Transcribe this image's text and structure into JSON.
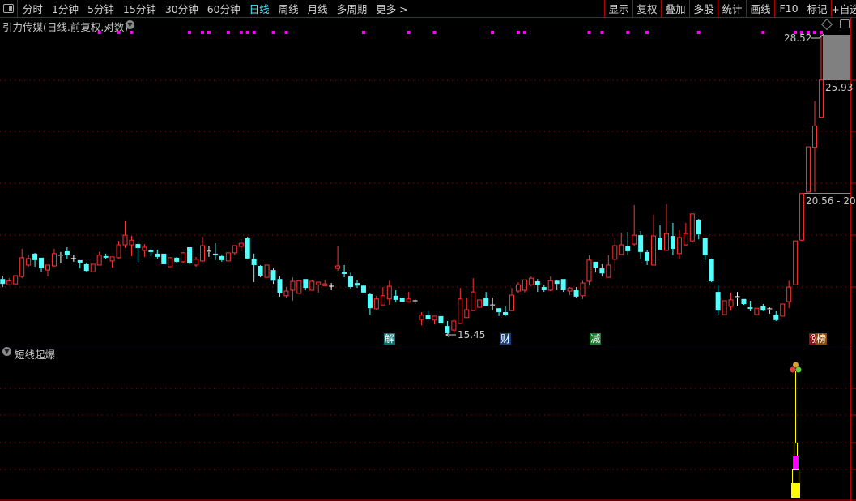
{
  "toolbar": {
    "periods": [
      {
        "label": "分时",
        "active": false
      },
      {
        "label": "1分钟",
        "active": false
      },
      {
        "label": "5分钟",
        "active": false
      },
      {
        "label": "15分钟",
        "active": false
      },
      {
        "label": "30分钟",
        "active": false
      },
      {
        "label": "60分钟",
        "active": false
      },
      {
        "label": "日线",
        "active": true
      },
      {
        "label": "周线",
        "active": false
      },
      {
        "label": "月线",
        "active": false
      },
      {
        "label": "多周期",
        "active": false
      },
      {
        "label": "更多 >",
        "active": false
      }
    ],
    "buttons": [
      "显示",
      "复权",
      "叠加",
      "多股",
      "统计",
      "画线",
      "F10",
      "标记",
      "+自选"
    ]
  },
  "main_panel": {
    "title": "引力传媒(日线.前复权.对数)",
    "labels": {
      "high": "28.52",
      "low": "15.45",
      "last": "25.93",
      "range": "20.56 - 20"
    },
    "badges": [
      {
        "text": "解",
        "candle": 60,
        "bg": "#0f6f70"
      },
      {
        "text": "财",
        "candle": 78,
        "bg": "#1a3f7a"
      },
      {
        "text": "减",
        "candle": 92,
        "bg": "#1a7a2a"
      },
      {
        "text": "涨",
        "candle": 126,
        "bg": "#8a0f0f"
      },
      {
        "text": "榜",
        "candle": 127,
        "bg": "#8a4a0f"
      }
    ]
  },
  "sub_panel": {
    "title": "短线起爆"
  },
  "colors": {
    "up": "#ff3232",
    "down": "#54ffff",
    "flat": "#ffffff",
    "grid": "#8a1010",
    "marker": "#ff00ff",
    "axis": "#c00000",
    "bg": "#000000"
  },
  "chart_data": {
    "type": "candlestick",
    "y_scale": "log",
    "grid": true,
    "ohlc_order": [
      "open",
      "high",
      "low",
      "close"
    ],
    "signal_markers": [
      15,
      18,
      20,
      29,
      31,
      32,
      35,
      37,
      38,
      39,
      42,
      44,
      56,
      63,
      67,
      76,
      80,
      81,
      91,
      93,
      97,
      100,
      108,
      118,
      123,
      124,
      125,
      126,
      127
    ],
    "candles": [
      [
        17.26,
        17.38,
        16.98,
        17.09
      ],
      [
        17.06,
        17.29,
        17.03,
        17.2
      ],
      [
        17.09,
        17.38,
        17.09,
        17.38
      ],
      [
        17.35,
        18.36,
        17.29,
        18.03
      ],
      [
        17.76,
        18.12,
        17.7,
        18.0
      ],
      [
        18.18,
        18.21,
        17.7,
        17.94
      ],
      [
        18.03,
        18.03,
        17.52,
        17.64
      ],
      [
        17.58,
        17.76,
        17.35,
        17.76
      ],
      [
        17.73,
        18.36,
        17.7,
        18.18
      ],
      [
        18.09,
        18.24,
        17.82,
        18.12
      ],
      [
        18.27,
        18.42,
        17.97,
        18.12
      ],
      [
        18.0,
        18.12,
        17.88,
        18.0
      ],
      [
        17.94,
        17.94,
        17.64,
        17.85
      ],
      [
        17.79,
        17.85,
        17.52,
        17.55
      ],
      [
        17.52,
        17.79,
        17.52,
        17.79
      ],
      [
        17.76,
        18.24,
        17.76,
        18.12
      ],
      [
        18.09,
        18.18,
        17.97,
        18.03
      ],
      [
        17.91,
        18.06,
        17.67,
        18.06
      ],
      [
        18.03,
        18.66,
        18.0,
        18.51
      ],
      [
        18.51,
        19.46,
        18.39,
        18.88
      ],
      [
        18.51,
        18.85,
        18.09,
        18.69
      ],
      [
        18.54,
        18.57,
        17.88,
        18.39
      ],
      [
        18.3,
        18.54,
        18.06,
        18.42
      ],
      [
        18.3,
        18.36,
        18.09,
        18.24
      ],
      [
        18.18,
        18.33,
        18.0,
        18.06
      ],
      [
        18.18,
        18.18,
        17.79,
        17.79
      ],
      [
        17.7,
        18.03,
        17.7,
        18.03
      ],
      [
        18.03,
        18.06,
        17.85,
        17.88
      ],
      [
        17.88,
        18.24,
        17.82,
        18.21
      ],
      [
        18.42,
        18.42,
        17.79,
        17.82
      ],
      [
        17.76,
        18.06,
        17.7,
        17.97
      ],
      [
        17.91,
        18.82,
        17.88,
        18.48
      ],
      [
        18.24,
        18.45,
        18.06,
        18.27
      ],
      [
        18.18,
        18.57,
        17.94,
        18.12
      ],
      [
        18.09,
        18.15,
        17.88,
        17.94
      ],
      [
        17.91,
        18.21,
        17.91,
        18.21
      ],
      [
        18.21,
        18.48,
        18.12,
        18.48
      ],
      [
        18.45,
        18.72,
        18.27,
        18.57
      ],
      [
        18.76,
        18.82,
        17.97,
        18.0
      ],
      [
        18.0,
        18.18,
        17.15,
        17.76
      ],
      [
        17.73,
        17.76,
        17.32,
        17.38
      ],
      [
        17.32,
        17.76,
        17.32,
        17.76
      ],
      [
        17.58,
        17.67,
        17.09,
        17.2
      ],
      [
        17.26,
        17.38,
        16.65,
        16.76
      ],
      [
        16.68,
        16.98,
        16.59,
        16.84
      ],
      [
        16.87,
        17.32,
        16.51,
        17.18
      ],
      [
        16.76,
        17.2,
        16.76,
        17.2
      ],
      [
        17.26,
        17.26,
        16.87,
        16.95
      ],
      [
        16.87,
        17.23,
        16.87,
        17.18
      ],
      [
        17.06,
        17.15,
        16.79,
        17.15
      ],
      [
        17.03,
        17.23,
        17.03,
        17.09
      ],
      [
        17.01,
        17.12,
        16.87,
        17.01
      ],
      [
        17.64,
        18.45,
        17.55,
        17.73
      ],
      [
        17.52,
        17.76,
        17.32,
        17.44
      ],
      [
        17.35,
        17.49,
        16.9,
        16.98
      ],
      [
        17.12,
        17.23,
        16.95,
        17.03
      ],
      [
        17.03,
        17.06,
        16.76,
        16.79
      ],
      [
        16.73,
        16.76,
        16.05,
        16.26
      ],
      [
        16.24,
        16.68,
        16.21,
        16.57
      ],
      [
        16.37,
        16.98,
        16.37,
        16.68
      ],
      [
        16.57,
        17.2,
        16.37,
        17.01
      ],
      [
        16.68,
        16.87,
        16.46,
        16.54
      ],
      [
        16.62,
        16.62,
        16.48,
        16.48
      ],
      [
        16.48,
        16.81,
        16.46,
        16.57
      ],
      [
        16.51,
        16.59,
        16.4,
        16.51
      ],
      [
        15.89,
        16.13,
        15.7,
        16.03
      ],
      [
        16.03,
        16.16,
        15.89,
        15.89
      ],
      [
        15.87,
        16.0,
        15.73,
        16.0
      ],
      [
        16.0,
        16.0,
        15.76,
        15.76
      ],
      [
        15.68,
        15.84,
        15.45,
        15.45
      ],
      [
        15.55,
        15.89,
        15.47,
        15.84
      ],
      [
        15.76,
        16.95,
        15.76,
        16.57
      ],
      [
        15.95,
        16.62,
        15.95,
        16.21
      ],
      [
        16.18,
        17.29,
        16.18,
        16.81
      ],
      [
        16.29,
        16.54,
        16.29,
        16.54
      ],
      [
        16.62,
        16.81,
        16.32,
        16.32
      ],
      [
        16.37,
        16.62,
        16.18,
        16.34
      ],
      [
        16.26,
        16.26,
        16.0,
        16.13
      ],
      [
        16.13,
        16.32,
        16.0,
        16.03
      ],
      [
        16.18,
        16.95,
        16.18,
        16.7
      ],
      [
        16.84,
        17.15,
        16.76,
        17.06
      ],
      [
        16.87,
        17.23,
        16.79,
        17.23
      ],
      [
        17.06,
        17.35,
        17.01,
        17.29
      ],
      [
        17.18,
        17.26,
        16.81,
        17.06
      ],
      [
        16.98,
        17.06,
        16.81,
        16.87
      ],
      [
        16.87,
        17.35,
        16.84,
        17.2
      ],
      [
        17.2,
        17.23,
        16.87,
        17.09
      ],
      [
        17.26,
        17.26,
        16.81,
        16.87
      ],
      [
        16.84,
        16.98,
        16.7,
        16.95
      ],
      [
        16.87,
        16.98,
        16.62,
        16.65
      ],
      [
        16.68,
        17.2,
        16.57,
        17.12
      ],
      [
        17.18,
        18.12,
        17.03,
        17.94
      ],
      [
        17.88,
        17.88,
        17.49,
        17.67
      ],
      [
        17.64,
        17.79,
        17.35,
        17.46
      ],
      [
        17.32,
        18.12,
        17.32,
        17.76
      ],
      [
        17.97,
        18.79,
        17.55,
        18.48
      ],
      [
        18.15,
        18.98,
        18.15,
        18.51
      ],
      [
        18.45,
        19.01,
        18.12,
        18.27
      ],
      [
        18.54,
        20.08,
        18.45,
        18.88
      ],
      [
        18.88,
        19.04,
        18.0,
        18.24
      ],
      [
        18.24,
        18.33,
        17.76,
        17.91
      ],
      [
        17.76,
        19.69,
        17.76,
        18.85
      ],
      [
        18.79,
        19.26,
        18.3,
        18.33
      ],
      [
        18.3,
        20.11,
        18.3,
        18.94
      ],
      [
        18.85,
        19.36,
        18.12,
        18.36
      ],
      [
        18.18,
        19.07,
        17.97,
        18.79
      ],
      [
        18.51,
        19.36,
        18.48,
        18.94
      ],
      [
        18.66,
        19.72,
        18.6,
        19.72
      ],
      [
        19.49,
        19.52,
        18.72,
        18.91
      ],
      [
        18.76,
        18.76,
        17.94,
        18.12
      ],
      [
        17.97,
        18.0,
        17.15,
        17.18
      ],
      [
        16.81,
        17.03,
        16.05,
        16.18
      ],
      [
        16.05,
        16.51,
        16.05,
        16.51
      ],
      [
        16.32,
        16.79,
        16.18,
        16.54
      ],
      [
        16.65,
        16.81,
        16.34,
        16.62
      ],
      [
        16.57,
        16.57,
        16.37,
        16.4
      ],
      [
        16.29,
        16.51,
        16.16,
        16.24
      ],
      [
        16.05,
        16.26,
        16.05,
        16.26
      ],
      [
        16.32,
        16.4,
        16.16,
        16.18
      ],
      [
        16.24,
        16.29,
        16.08,
        16.21
      ],
      [
        16.05,
        16.16,
        15.84,
        15.87
      ],
      [
        16.0,
        16.4,
        16.0,
        16.4
      ],
      [
        16.48,
        17.2,
        16.26,
        16.98
      ],
      [
        17.06,
        18.66,
        17.06,
        18.66
      ],
      [
        18.69,
        20.56,
        18.66,
        20.56
      ],
      [
        20.62,
        22.62,
        20.62,
        22.62
      ],
      [
        22.6,
        24.84,
        20.62,
        23.6
      ],
      [
        24.03,
        28.52,
        24.03,
        25.93
      ]
    ]
  }
}
